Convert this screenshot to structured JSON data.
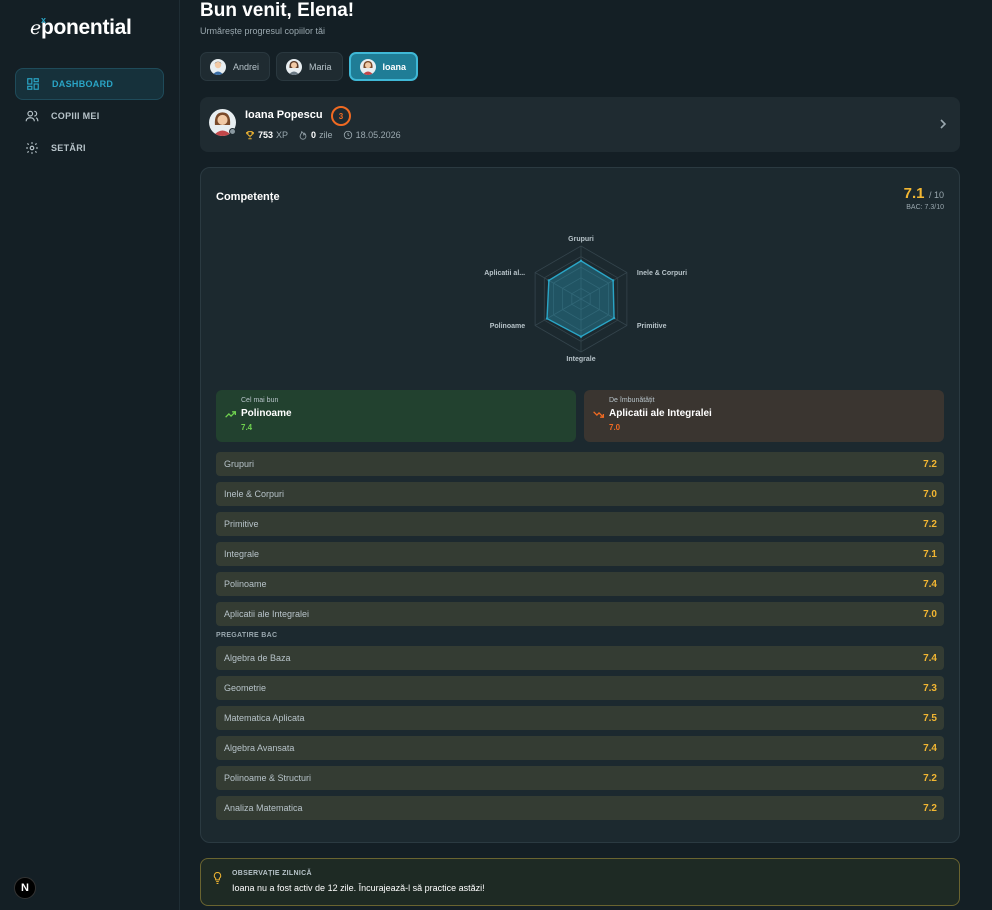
{
  "app": {
    "logo_prefix": "e",
    "logo_sup": "x",
    "logo_rest": "ponential"
  },
  "sidebar": {
    "items": [
      {
        "label": "DASHBOARD",
        "icon": "dashboard-icon",
        "active": true
      },
      {
        "label": "COPIII MEI",
        "icon": "users-icon",
        "active": false
      },
      {
        "label": "SETĂRI",
        "icon": "gear-icon",
        "active": false
      }
    ],
    "footer_badge": "N"
  },
  "header": {
    "welcome": "Bun venit, Elena!",
    "subtitle": "Urmărește progresul copiilor tăi"
  },
  "kids": [
    {
      "name": "Andrei",
      "active": false
    },
    {
      "name": "Maria",
      "active": false
    },
    {
      "name": "Ioana",
      "active": true
    }
  ],
  "profile": {
    "name": "Ioana Popescu",
    "level": "3",
    "xp_value": "753",
    "xp_unit": "XP",
    "streak_value": "0",
    "streak_unit": "zile",
    "date": "18.05.2026"
  },
  "competencies": {
    "title": "Competențe",
    "score": "7.1",
    "score_of": "/ 10",
    "bac": "BAC: 7.3/10",
    "best": {
      "label": "Cel mai bun",
      "name": "Polinoame",
      "score": "7.4"
    },
    "improve": {
      "label": "De îmbunătățit",
      "name": "Aplicatii ale Integralei",
      "score": "7.0"
    },
    "items": [
      {
        "name": "Grupuri",
        "value": "7.2"
      },
      {
        "name": "Inele & Corpuri",
        "value": "7.0"
      },
      {
        "name": "Primitive",
        "value": "7.2"
      },
      {
        "name": "Integrale",
        "value": "7.1"
      },
      {
        "name": "Polinoame",
        "value": "7.4"
      },
      {
        "name": "Aplicatii ale Integralei",
        "value": "7.0"
      }
    ],
    "bac_section_label": "PREGATIRE BAC",
    "bac_items": [
      {
        "name": "Algebra de Baza",
        "value": "7.4"
      },
      {
        "name": "Geometrie",
        "value": "7.3"
      },
      {
        "name": "Matematica Aplicata",
        "value": "7.5"
      },
      {
        "name": "Algebra Avansata",
        "value": "7.4"
      },
      {
        "name": "Polinoame & Structuri",
        "value": "7.2"
      },
      {
        "name": "Analiza Matematica",
        "value": "7.2"
      }
    ]
  },
  "chart_data": {
    "type": "radar",
    "categories": [
      "Grupuri",
      "Inele & Corpuri",
      "Primitive",
      "Integrale",
      "Polinoame",
      "Aplicatii al..."
    ],
    "values": [
      7.2,
      7.0,
      7.2,
      7.1,
      7.4,
      7.0
    ],
    "ylim": [
      0,
      10
    ],
    "grid": true
  },
  "observation": {
    "title": "OBSERVAȚIE ZILNICĂ",
    "text": "Ioana nu a fost activ de 12 zile. Încurajează-l să practice astăzi!"
  },
  "colors": {
    "accent": "#2aa5c6",
    "score": "#f2b632",
    "best": "#6fd14f",
    "improve": "#f06a22"
  }
}
